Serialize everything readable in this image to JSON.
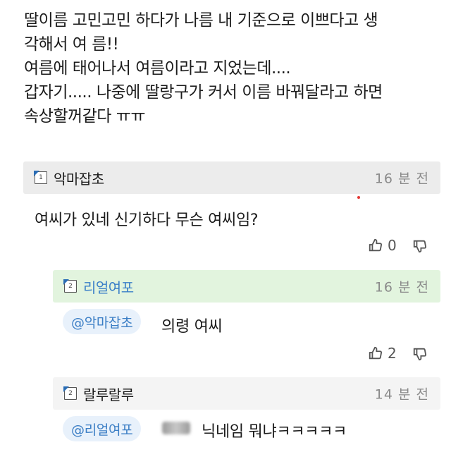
{
  "post": {
    "lines": [
      "딸이름 고민고민 하다가 나름 내 기준으로 이쁘다고 생",
      "각해서 여 름!!",
      "여름에 태어나서 여름이라고 지었는데....",
      "갑자기..... 나중에 딸랑구가 커서 이름 바꿔달라고 하면",
      "속상할꺼같다 ㅠㅠ"
    ]
  },
  "comments": [
    {
      "nickname": "악마잡초",
      "level_icon": "level-1-icon",
      "level_text": "1",
      "time": "16 분 전",
      "text": "여씨가 있네 신기하다 무슨 여씨임?",
      "likes": "0"
    },
    {
      "nickname": "리얼여포",
      "level_icon": "level-2-icon",
      "level_text": "2",
      "time": "16 분 전",
      "mention": "@악마잡초",
      "text": "의령 여씨",
      "likes": "2"
    },
    {
      "nickname": "랄루랄루",
      "level_icon": "level-2-icon",
      "level_text": "2",
      "time": "14 분 전",
      "mention": "@리얼여포",
      "text": "닉네임 뭐냐ㅋㅋㅋㅋㅋ"
    }
  ],
  "icons": {
    "like": "thumbs-up-icon",
    "dislike": "thumbs-down-icon"
  },
  "colors": {
    "mention_text": "#3b7ec5",
    "reply_header": "#e2f4de",
    "accent": "#2a6db5"
  }
}
